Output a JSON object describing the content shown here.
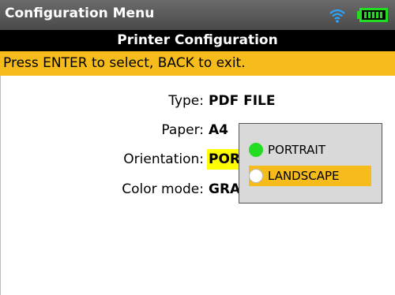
{
  "header": {
    "title": "Configuration Menu"
  },
  "status": {
    "wifi_icon": "wifi-icon",
    "battery_icon": "battery-icon",
    "wifi_color": "#2aa4ff",
    "battery_color": "#22dd22"
  },
  "subheader": {
    "title": "Printer Configuration"
  },
  "hint": {
    "text": "Press ENTER to select, BACK to exit."
  },
  "fields": [
    {
      "label": "Type:",
      "value": "PDF FILE"
    },
    {
      "label": "Paper:",
      "value": "A4"
    },
    {
      "label": "Orientation:",
      "value": "POR"
    },
    {
      "label": "Color mode:",
      "value": "GRA"
    }
  ],
  "popup": {
    "options": [
      {
        "label": "PORTRAIT",
        "icon": "green-dot-icon",
        "color": "#22dd22"
      },
      {
        "label": "LANDSCAPE",
        "icon": "white-dot-icon",
        "color": "#ffffff"
      }
    ],
    "selected": "LANDSCAPE"
  },
  "colors": {
    "accent": "#f5bc1c",
    "highlight": "#ffff00"
  }
}
